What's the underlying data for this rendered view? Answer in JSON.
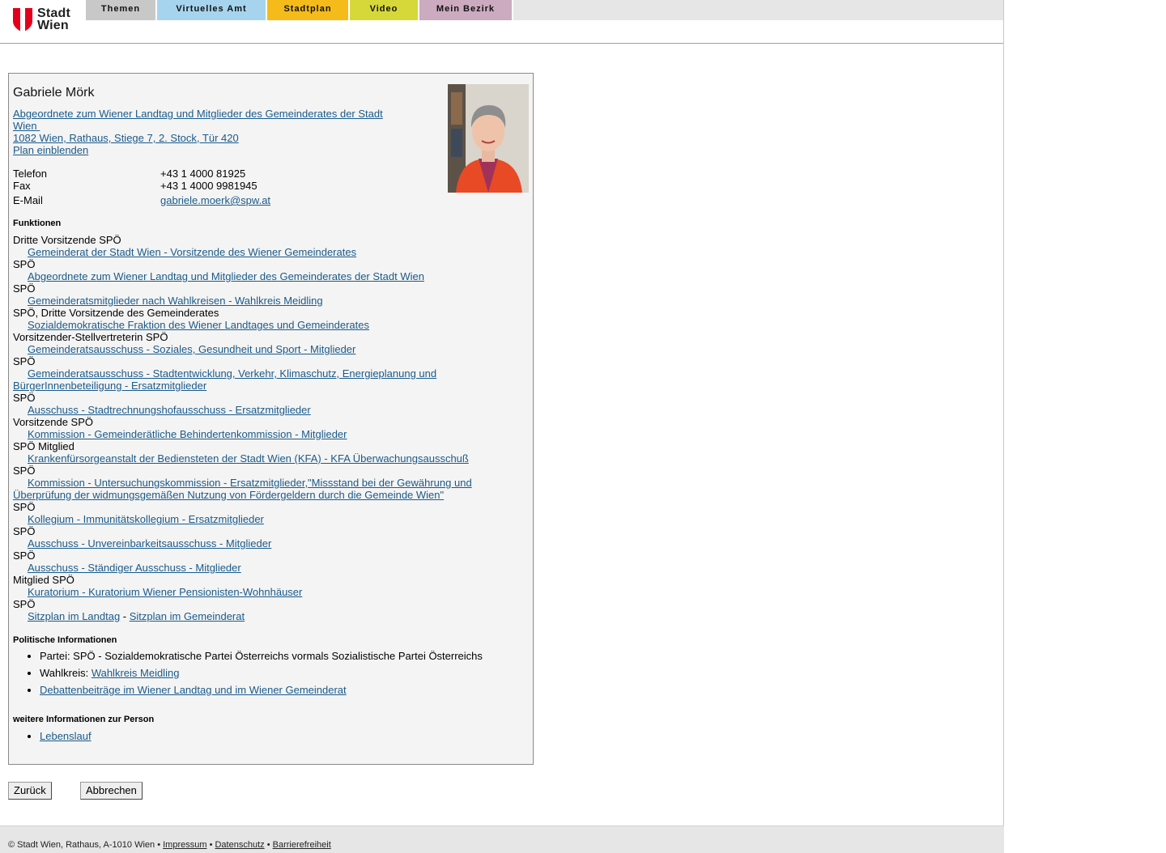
{
  "header": {
    "logo_line1": "Stadt",
    "logo_line2": "Wien",
    "nav": [
      {
        "label": "Themen",
        "color": "#c8c8c8"
      },
      {
        "label": "Virtuelles Amt",
        "color": "#a6d4ee"
      },
      {
        "label": "Stadtplan",
        "color": "#f5bb1a"
      },
      {
        "label": "Video",
        "color": "#d6d83a"
      },
      {
        "label": "Mein Bezirk",
        "color": "#ccaabf"
      }
    ]
  },
  "person": {
    "name": "Gabriele Mörk",
    "position_line1": "Abgeordnete zum Wiener Landtag und Mitglieder des Gemeinderates der Stadt",
    "position_line2": "Wien",
    "address": "1082 Wien, Rathaus, Stiege 7, 2. Stock, Tür 420",
    "map_link": "Plan einblenden",
    "contact": [
      {
        "label": "Telefon",
        "value": "+43 1 4000 81925"
      },
      {
        "label": "Fax",
        "value": "+43 1 4000 9981945"
      },
      {
        "label": "E-Mail",
        "value": "gabriele.moerk@spw.at"
      }
    ]
  },
  "functions": {
    "heading": "Funktionen",
    "items": [
      {
        "role": "Dritte Vorsitzende SPÖ",
        "link": "Gemeinderat der Stadt Wien - Vorsitzende des Wiener Gemeinderates"
      },
      {
        "role": "SPÖ",
        "link": "Abgeordnete zum Wiener Landtag und Mitglieder des Gemeinderates der Stadt Wien"
      },
      {
        "role": "SPÖ",
        "link": "Gemeinderatsmitglieder nach Wahlkreisen - Wahlkreis Meidling"
      },
      {
        "role": "SPÖ, Dritte Vorsitzende des Gemeinderates",
        "link": "Sozialdemokratische Fraktion des Wiener Landtages und Gemeinderates"
      },
      {
        "role": "Vorsitzender-Stellvertreterin SPÖ",
        "link": "Gemeinderatsausschuss - Soziales, Gesundheit und Sport - Mitglieder"
      },
      {
        "role": "SPÖ",
        "link": "Gemeinderatsausschuss - Stadtentwicklung, Verkehr, Klimaschutz, Energieplanung und BürgerInnenbeteiligung - Ersatzmitglieder"
      },
      {
        "role": "SPÖ",
        "link": "Ausschuss - Stadtrechnungshofausschuss - Ersatzmitglieder"
      },
      {
        "role": "Vorsitzende SPÖ",
        "link": "Kommission - Gemeinderätliche Behindertenkommission - Mitglieder"
      },
      {
        "role": "SPÖ Mitglied",
        "link": "Krankenfürsorgeanstalt der Bediensteten der Stadt Wien (KFA) - KFA Überwachungsausschuß"
      },
      {
        "role": "SPÖ",
        "link": "Kommission - Untersuchungskommission - Ersatzmitglieder,\"Missstand bei der Gewährung und Überprüfung der widmungsgemäßen Nutzung von Fördergeldern durch die Gemeinde Wien\""
      },
      {
        "role": "SPÖ",
        "link": "Kollegium - Immunitätskollegium - Ersatzmitglieder"
      },
      {
        "role": "SPÖ",
        "link": "Ausschuss - Unvereinbarkeitsausschuss - Mitglieder"
      },
      {
        "role": "SPÖ",
        "link": "Ausschuss - Ständiger Ausschuss - Mitglieder"
      },
      {
        "role": "Mitglied SPÖ",
        "link": "Kuratorium - Kuratorium Wiener Pensionisten-Wohnhäuser"
      },
      {
        "role": "SPÖ",
        "link": null
      }
    ],
    "seat_landtag": "Sitzplan im Landtag",
    "seat_separator": " - ",
    "seat_gemeinderat": "Sitzplan im Gemeinderat"
  },
  "political": {
    "heading": "Politische Informationen",
    "party": "Partei: SPÖ - Sozialdemokratische Partei Österreichs vormals Sozialistische Partei Österreichs",
    "wahlkreis_label": "Wahlkreis: ",
    "wahlkreis_link": "Wahlkreis Meidling",
    "debates_link": "Debattenbeiträge im Wiener Landtag und im Wiener Gemeinderat"
  },
  "more": {
    "heading": "weitere Informationen zur Person",
    "cv_link": "Lebenslauf"
  },
  "buttons": {
    "back": "Zurück",
    "cancel": "Abbrechen"
  },
  "footer": {
    "copyright": "© Stadt Wien, Rathaus, A-1010 Wien • ",
    "imprint": "Impressum",
    "sep": " • ",
    "privacy": "Datenschutz",
    "accessibility": "Barrierefreiheit"
  }
}
